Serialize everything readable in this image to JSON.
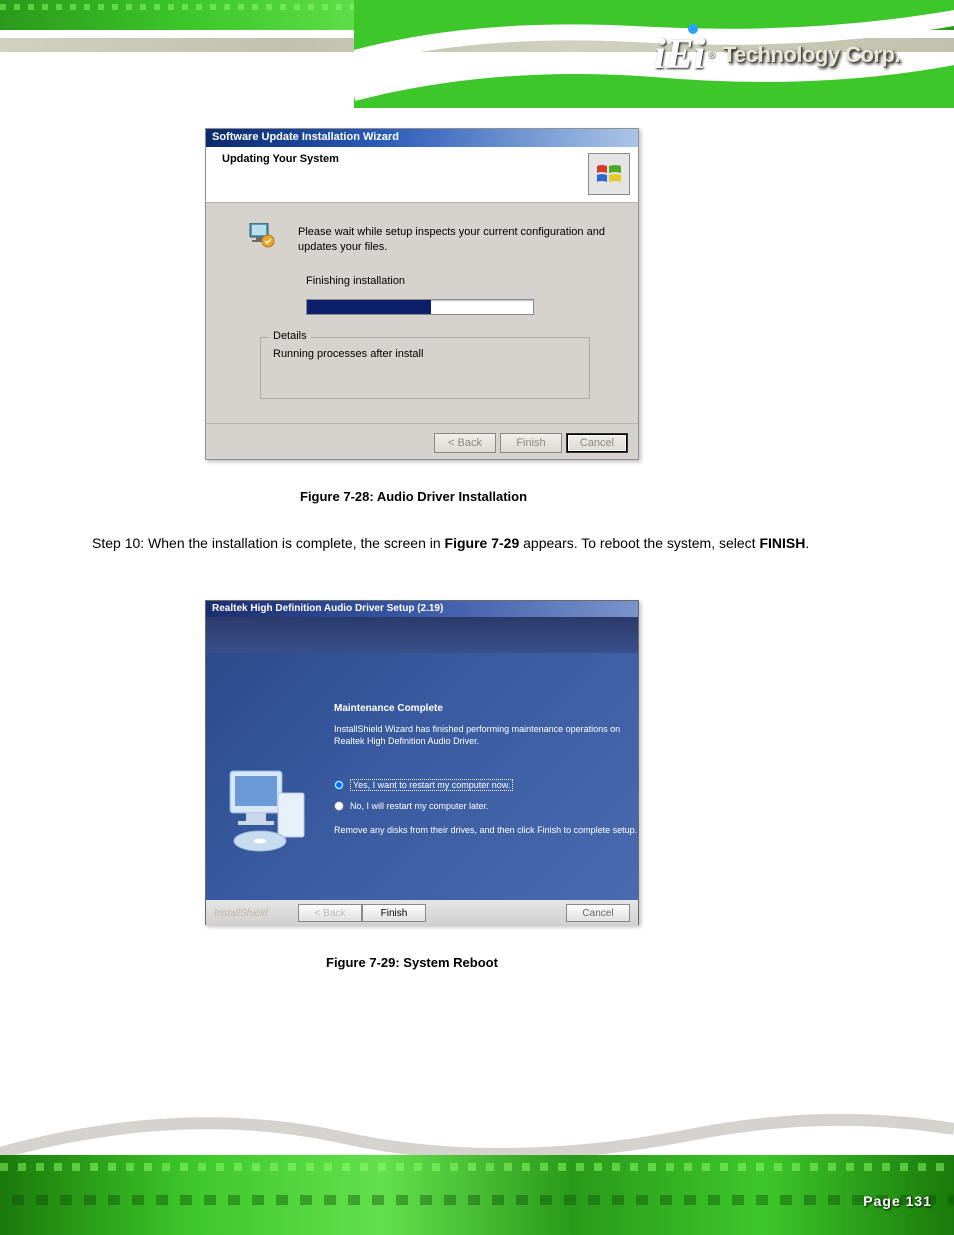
{
  "header": {
    "brand_prefix": "iEi",
    "brand_reg": "®",
    "brand_text": "Technology Corp."
  },
  "dialog1": {
    "title": "Software Update Installation Wizard",
    "heading": "Updating Your System",
    "body_text": "Please wait while setup inspects your current configuration and updates your files.",
    "status": "Finishing installation",
    "details_label": "Details",
    "details_text": "Running processes after install",
    "btn_back": "< Back",
    "btn_finish": "Finish",
    "btn_cancel": "Cancel"
  },
  "caption1": "Figure 7-28: Audio Driver Installation",
  "step": {
    "prefix": "Step 10: ",
    "text1": "When the installation is complete, the screen in ",
    "ref": "Figure 7-29",
    "text2": " appears. To reboot the system, select ",
    "bold": "FINISH",
    "text3": "."
  },
  "dialog2": {
    "title": "Realtek High Definition Audio Driver Setup (2.19)",
    "heading": "Maintenance Complete",
    "body_text": "InstallShield Wizard has finished performing maintenance operations on Realtek High Definition Audio Driver.",
    "radio_yes": "Yes, I want to restart my computer now.",
    "radio_no": "No, I will restart my computer later.",
    "remove_text": "Remove any disks from their drives, and then click Finish to complete setup.",
    "brand": "InstallShield",
    "btn_back": "< Back",
    "btn_finish": "Finish",
    "btn_cancel": "Cancel"
  },
  "caption2": "Figure 7-29: System Reboot",
  "footer": {
    "page": "Page 131"
  }
}
